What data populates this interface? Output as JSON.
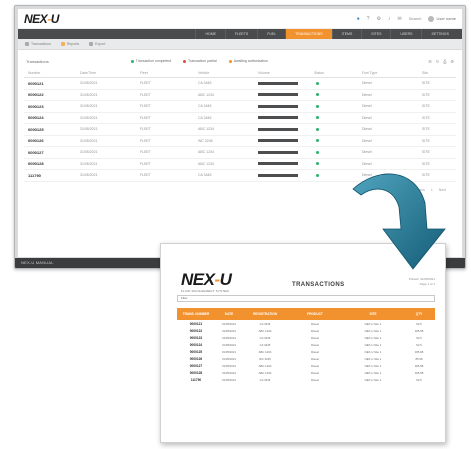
{
  "app": {
    "logo_text": "NEX-U",
    "topbar": {
      "search_label": "Search",
      "user_label": "User name"
    },
    "nav": [
      "HOME",
      "FLEETS",
      "FUEL",
      "TRANSACTIONS",
      "ITEMS",
      "SITES",
      "USERS",
      "SETTINGS"
    ],
    "nav_active_index": 3,
    "subbar": [
      {
        "label": "Transactions",
        "icon": "list-icon"
      },
      {
        "label": "Reports",
        "icon": "chart-icon"
      },
      {
        "label": "Export",
        "icon": "export-icon"
      }
    ],
    "toolbar_title": "Transactions",
    "legend": [
      {
        "label": "Transaction completed",
        "color": "#2bb36b"
      },
      {
        "label": "Transaction partial",
        "color": "#e24a3b"
      },
      {
        "label": "Awaiting authorization",
        "color": "#f2922e"
      }
    ],
    "columns": [
      "Number",
      "Date/Time",
      "Fleet",
      "Vehicle",
      "Volume",
      "Status",
      "Fuel Type",
      "Site"
    ],
    "rows": [
      {
        "id": "0000121",
        "date": "31/05/2021",
        "fleet": "FLEET",
        "vehicle": "CA 3445",
        "fuel": "Diesel",
        "site": "SITE"
      },
      {
        "id": "0000122",
        "date": "31/05/2021",
        "fleet": "FLEET",
        "vehicle": "ABC 1234",
        "fuel": "Diesel",
        "site": "SITE"
      },
      {
        "id": "0000123",
        "date": "31/05/2021",
        "fleet": "FLEET",
        "vehicle": "CA 3445",
        "fuel": "Diesel",
        "site": "SITE"
      },
      {
        "id": "0000124",
        "date": "31/05/2021",
        "fleet": "FLEET",
        "vehicle": "CA 3445",
        "fuel": "Diesel",
        "site": "SITE"
      },
      {
        "id": "0000125",
        "date": "31/05/2021",
        "fleet": "FLEET",
        "vehicle": "ABC 1234",
        "fuel": "Diesel",
        "site": "SITE"
      },
      {
        "id": "0000126",
        "date": "31/05/2021",
        "fleet": "FLEET",
        "vehicle": "WC 3245",
        "fuel": "Diesel",
        "site": "SITE"
      },
      {
        "id": "0000127",
        "date": "31/05/2021",
        "fleet": "FLEET",
        "vehicle": "ABC 1234",
        "fuel": "Diesel",
        "site": "SITE"
      },
      {
        "id": "0000128",
        "date": "31/05/2021",
        "fleet": "FLEET",
        "vehicle": "ABC 1234",
        "fuel": "Diesel",
        "site": "SITE"
      },
      {
        "id": "111790",
        "date": "31/05/2021",
        "fleet": "FLEET",
        "vehicle": "CA 3445",
        "fuel": "Diesel",
        "site": "SITE"
      }
    ],
    "pager": [
      "Previous",
      "1",
      "Next"
    ],
    "status_text": "NEX-U MANUAL"
  },
  "report": {
    "logo_text": "NEX-U",
    "tagline": "FLUID MANAGEMENT SYSTEM",
    "title": "TRANSACTIONS",
    "meta_date": "Printed: 31/05/2021",
    "meta_page": "Page 1 of 1",
    "filter_label": "Filter",
    "columns": [
      "TRANS. NUMBER",
      "DATE",
      "REGISTRATION",
      "PRODUCT",
      "SITE",
      "QTY"
    ],
    "rows": [
      {
        "id": "0000121",
        "date": "31/05/2021",
        "reg": "CA 3445",
        "product": "Diesel",
        "site": "NEX-U Site 1",
        "qty": "52.6"
      },
      {
        "id": "0000122",
        "date": "31/05/2021",
        "reg": "ABC 1234",
        "product": "Diesel",
        "site": "NEX-U Site 1",
        "qty": "185.98"
      },
      {
        "id": "0000123",
        "date": "31/05/2021",
        "reg": "CA 3445",
        "product": "Diesel",
        "site": "NEX-U Site 1",
        "qty": "52.6"
      },
      {
        "id": "0000124",
        "date": "31/05/2021",
        "reg": "CA 3445",
        "product": "Diesel",
        "site": "NEX-U Site 1",
        "qty": "52.6"
      },
      {
        "id": "0000125",
        "date": "31/05/2021",
        "reg": "ABC 1234",
        "product": "Diesel",
        "site": "NEX-U Site 1",
        "qty": "185.98"
      },
      {
        "id": "0000126",
        "date": "31/05/2021",
        "reg": "WC 3245",
        "product": "Diesel",
        "site": "NEX-U Site 1",
        "qty": "85.98"
      },
      {
        "id": "0000127",
        "date": "31/05/2021",
        "reg": "ABC 1234",
        "product": "Diesel",
        "site": "NEX-U Site 1",
        "qty": "185.98"
      },
      {
        "id": "0000128",
        "date": "31/05/2021",
        "reg": "ABC 1234",
        "product": "Diesel",
        "site": "NEX-U Site 1",
        "qty": "185.98"
      },
      {
        "id": "111790",
        "date": "31/05/2021",
        "reg": "CA 3445",
        "product": "Diesel",
        "site": "NEX-U Site 1",
        "qty": "52.6"
      }
    ]
  },
  "colors": {
    "accent": "#f2922e",
    "arrow": "#1a6f8a",
    "nav_bg": "#4a4b4d",
    "status_ok": "#2bb36b"
  }
}
